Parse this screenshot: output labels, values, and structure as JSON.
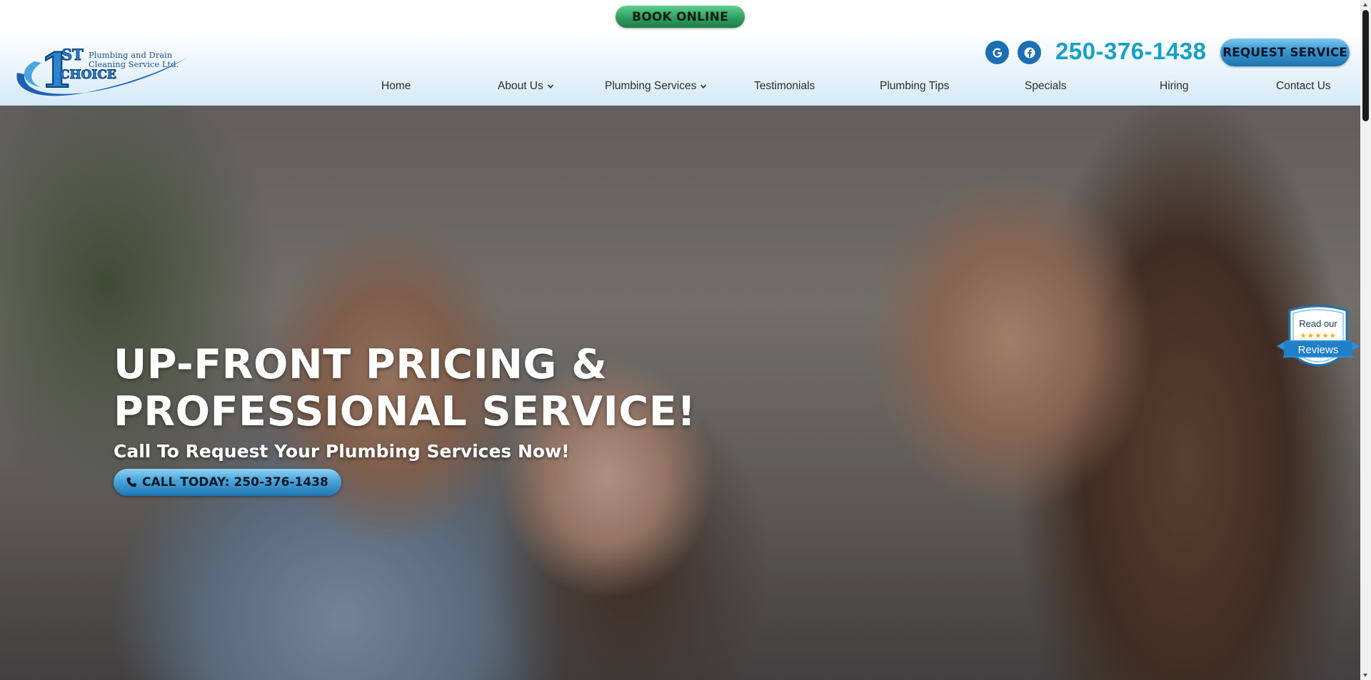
{
  "header": {
    "book_online_label": "BOOK ONLINE",
    "logo": {
      "mark_primary": "1",
      "mark_superscript": "ST",
      "mark_word": "CHOICE",
      "tagline_line1": "Plumbing and Drain",
      "tagline_line2": "Cleaning Service Ltd."
    },
    "social": [
      {
        "name": "google-icon",
        "glyph": "G"
      },
      {
        "name": "facebook-icon",
        "glyph": "f"
      }
    ],
    "phone": "250-376-1438",
    "request_label": "REQUEST SERVICE",
    "nav": [
      {
        "label": "Home",
        "dropdown": false
      },
      {
        "label": "About Us",
        "dropdown": true
      },
      {
        "label": "Plumbing Services",
        "dropdown": true
      },
      {
        "label": "Testimonials",
        "dropdown": false
      },
      {
        "label": "Plumbing Tips",
        "dropdown": false
      },
      {
        "label": "Specials",
        "dropdown": false
      },
      {
        "label": "Hiring",
        "dropdown": false
      },
      {
        "label": "Contact Us",
        "dropdown": false
      }
    ]
  },
  "hero": {
    "title_line1": "UP-FRONT PRICING &",
    "title_line2": "PROFESSIONAL SERVICE!",
    "subtitle": "Call To Request Your Plumbing Services Now!",
    "call_label": "CALL TODAY: 250-376-1438"
  },
  "reviews_badge": {
    "line1": "Read our",
    "stars": "★★★★★",
    "line2": "Reviews"
  },
  "colors": {
    "book_online": "#2f9e5f",
    "accent_blue": "#1e73b0",
    "phone_text": "#16a0c8",
    "social_bg": "#1a6fb4",
    "logo_blue": "#1c4fa0"
  }
}
